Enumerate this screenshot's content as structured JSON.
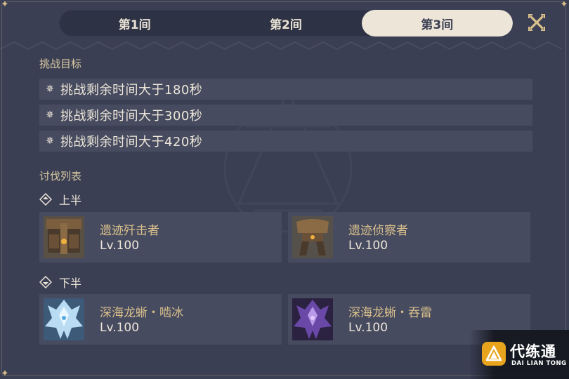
{
  "tabs": [
    "第1间",
    "第2间",
    "第3间"
  ],
  "active_tab_index": 2,
  "icons": {
    "close": "close-cross-icon",
    "goal": "star-burst-icon",
    "half": "diamond-marker-icon",
    "corner": "corner-star-icon"
  },
  "goals": {
    "title": "挑战目标",
    "items": [
      "挑战剩余时间大于180秒",
      "挑战剩余时间大于300秒",
      "挑战剩余时间大于420秒"
    ]
  },
  "enemies": {
    "title": "讨伐列表",
    "first_half": {
      "label": "上半",
      "list": [
        {
          "name": "遗迹歼击者",
          "level": "Lv.100"
        },
        {
          "name": "遗迹侦察者",
          "level": "Lv.100"
        }
      ]
    },
    "second_half": {
      "label": "下半",
      "list": [
        {
          "name": "深海龙蜥・啮冰",
          "level": "Lv.100"
        },
        {
          "name": "深海龙蜥・吞雷",
          "level": "Lv.100"
        }
      ]
    }
  },
  "watermark": {
    "cn": "代练通",
    "en": "DAI LIAN TONG"
  },
  "colors": {
    "background": "#3b3f54",
    "row": "#474b60",
    "gold": "#d9c08b",
    "text": "#ece5d8",
    "tab_active": "#ece5d8"
  }
}
